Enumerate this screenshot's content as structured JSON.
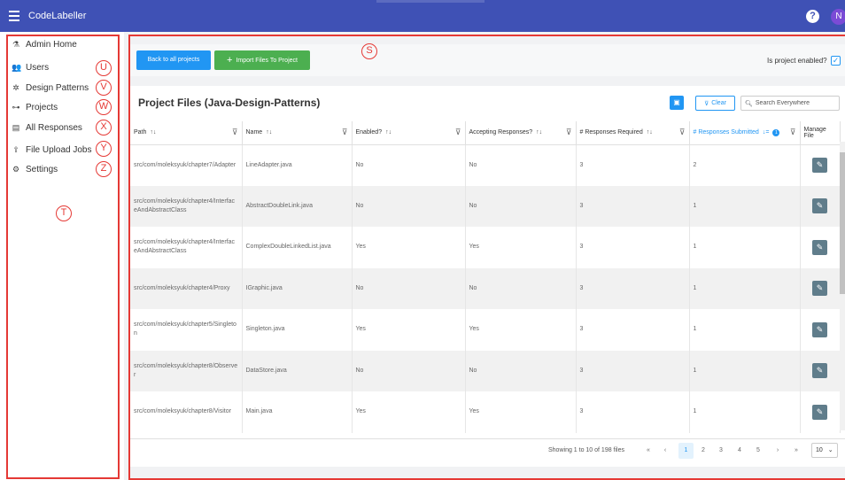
{
  "app": {
    "title": "CodeLabeller",
    "avatar_initial": "N",
    "help": "?"
  },
  "sidebar": {
    "items": [
      {
        "label": "Admin Home",
        "icon": "flask-icon"
      },
      {
        "label": "Users",
        "icon": "users-icon"
      },
      {
        "label": "Design Patterns",
        "icon": "puzzle-icon"
      },
      {
        "label": "Projects",
        "icon": "sitemap-icon"
      },
      {
        "label": "All Responses",
        "icon": "list-icon"
      },
      {
        "label": "File Upload Jobs",
        "icon": "upload-icon"
      },
      {
        "label": "Settings",
        "icon": "gear-icon"
      }
    ]
  },
  "markers": {
    "s": "S",
    "t": "T",
    "u": "U",
    "v": "V",
    "w": "W",
    "x": "X",
    "y": "Y",
    "z": "Z"
  },
  "toolbar": {
    "back_label": "Back to all projects",
    "import_label": "Import Files To Project",
    "enabled_label": "Is project enabled?"
  },
  "card": {
    "title": "Project Files (Java-Design-Patterns)",
    "clear_label": "Clear",
    "search_placeholder": "Search Everywhere"
  },
  "table": {
    "headers": {
      "path": "Path",
      "name": "Name",
      "enabled": "Enabled?",
      "accepting": "Accepting Responses?",
      "required": "# Responses Required",
      "submitted": "# Responses Submitted",
      "submitted_badge": "1",
      "manage": "Manage File"
    },
    "rows": [
      {
        "path": "src/com/moleksyuk/chapter7/Adapter",
        "name": "LineAdapter.java",
        "enabled": "No",
        "accepting": "No",
        "required": "3",
        "submitted": "2"
      },
      {
        "path": "src/com/moleksyuk/chapter4/InterfaceAndAbstractClass",
        "name": "AbstractDoubleLink.java",
        "enabled": "No",
        "accepting": "No",
        "required": "3",
        "submitted": "1"
      },
      {
        "path": "src/com/moleksyuk/chapter4/InterfaceAndAbstractClass",
        "name": "ComplexDoubleLinkedList.java",
        "enabled": "Yes",
        "accepting": "Yes",
        "required": "3",
        "submitted": "1"
      },
      {
        "path": "src/com/moleksyuk/chapter4/Proxy",
        "name": "IGraphic.java",
        "enabled": "No",
        "accepting": "No",
        "required": "3",
        "submitted": "1"
      },
      {
        "path": "src/com/moleksyuk/chapter5/Singleton",
        "name": "Singleton.java",
        "enabled": "Yes",
        "accepting": "Yes",
        "required": "3",
        "submitted": "1"
      },
      {
        "path": "src/com/moleksyuk/chapter8/Observer",
        "name": "DataStore.java",
        "enabled": "No",
        "accepting": "No",
        "required": "3",
        "submitted": "1"
      },
      {
        "path": "src/com/moleksyuk/chapter8/Visitor",
        "name": "Main.java",
        "enabled": "Yes",
        "accepting": "Yes",
        "required": "3",
        "submitted": "1"
      }
    ]
  },
  "pagination": {
    "info": "Showing 1 to 10 of 198 files",
    "first": "«",
    "prev": "‹",
    "pages": [
      "1",
      "2",
      "3",
      "4",
      "5"
    ],
    "current": "1",
    "next": "›",
    "last": "»",
    "rows_per_page": "10"
  },
  "colors": {
    "topbar": "#3f51b5",
    "primary": "#2196f3",
    "success": "#4caf50",
    "annotation": "#e53935"
  }
}
